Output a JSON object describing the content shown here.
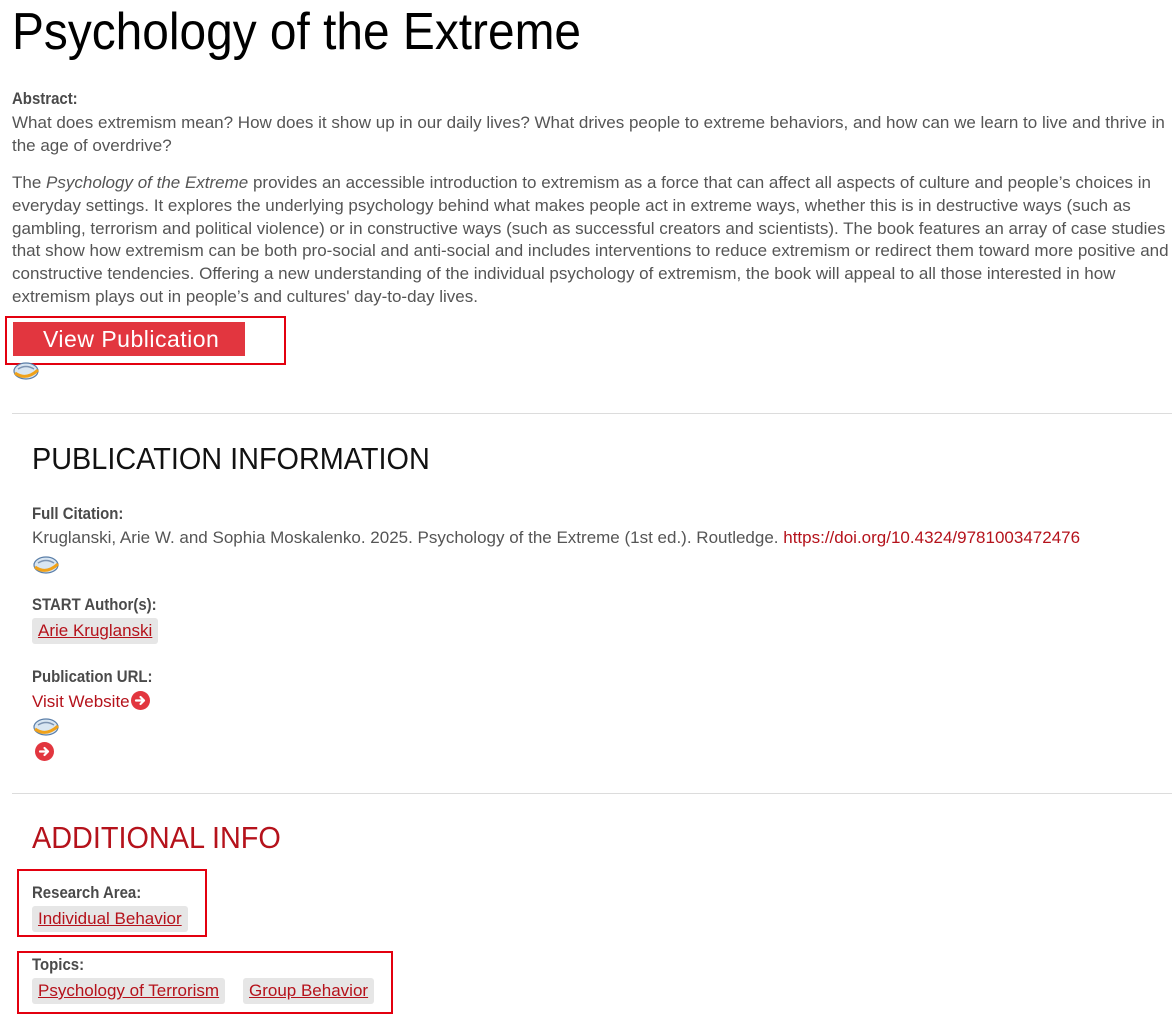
{
  "page": {
    "title": "Psychology of the Extreme"
  },
  "abstract": {
    "label": "Abstract:",
    "para1": "What does extremism mean? How does it show up in our daily lives? What drives people to extreme behaviors, and how can we learn to live and thrive in the age of overdrive?",
    "para2_prefix": "The ",
    "para2_italic": "Psychology of the Extreme",
    "para2_rest": " provides an accessible introduction to extremism as a force that can affect all aspects of culture and people’s choices in everyday settings. It explores the underlying psychology behind what makes people act in extreme ways, whether this is in destructive ways (such as gambling, terrorism and political violence) or in constructive ways (such as successful creators and scientists). The book features an array of case studies that show how extremism can be both pro-social and anti-social and includes interventions to reduce extremism or redirect them toward more positive and constructive tendencies. Offering a new understanding of the individual psychology of extremism, the book will appeal to all those interested in how extremism plays out in people’s and cultures' day-to-day lives."
  },
  "view_button": {
    "label": "View Publication"
  },
  "publication_info": {
    "heading": "PUBLICATION INFORMATION",
    "full_citation_label": "Full Citation:",
    "citation_text": "Kruglanski, Arie W. and Sophia Moskalenko. 2025. Psychology of the Extreme (1st ed.). Routledge. ",
    "doi_link": "https://doi.org/10.4324/9781003472476",
    "authors_label": "START Author(s):",
    "authors": [
      "Arie Kruglanski"
    ],
    "url_label": "Publication URL:",
    "visit_link": "Visit Website"
  },
  "additional_info": {
    "heading": "ADDITIONAL INFO",
    "research_area_label": "Research Area:",
    "research_areas": [
      "Individual Behavior"
    ],
    "topics_label": "Topics:",
    "topics": [
      "Psychology of Terrorism",
      "Group Behavior"
    ]
  },
  "colors": {
    "accent_red": "#b5121b",
    "button_red": "#e2363f",
    "tag_bg": "#e6e6e6",
    "highlight": "#e3000f"
  },
  "icons": [
    "citation-manager-icon",
    "arrow-right-circle-icon"
  ]
}
